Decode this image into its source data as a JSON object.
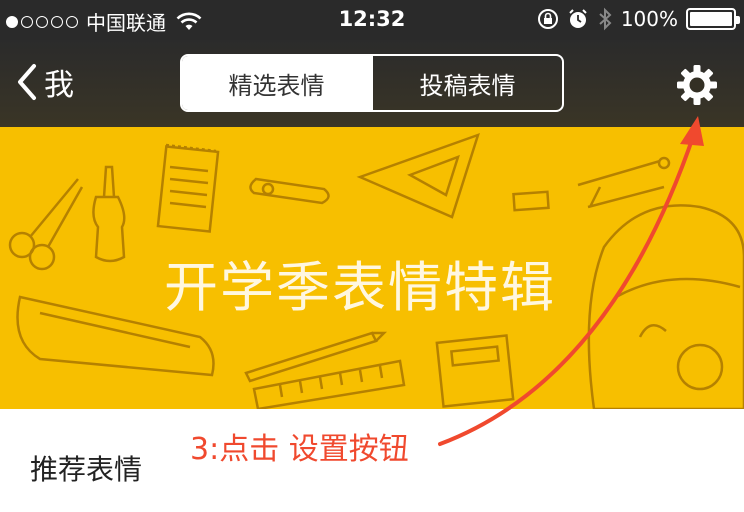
{
  "status_bar": {
    "carrier": "中国联通",
    "time": "12:32",
    "battery": "100%",
    "battery_level": 1.0,
    "signal_bars_filled": 1,
    "signal_bars_total": 5
  },
  "nav": {
    "back_label": "我",
    "tabs": [
      {
        "label": "精选表情",
        "active": true
      },
      {
        "label": "投稿表情",
        "active": false
      }
    ]
  },
  "banner": {
    "title": "开学季表情特辑"
  },
  "section": {
    "title": "推荐表情"
  },
  "annotation": {
    "text": "3:点击  设置按钮",
    "color": "#f0492e"
  },
  "colors": {
    "banner_bg": "#f7bf00",
    "nav_bg": "#2b2b2b"
  }
}
